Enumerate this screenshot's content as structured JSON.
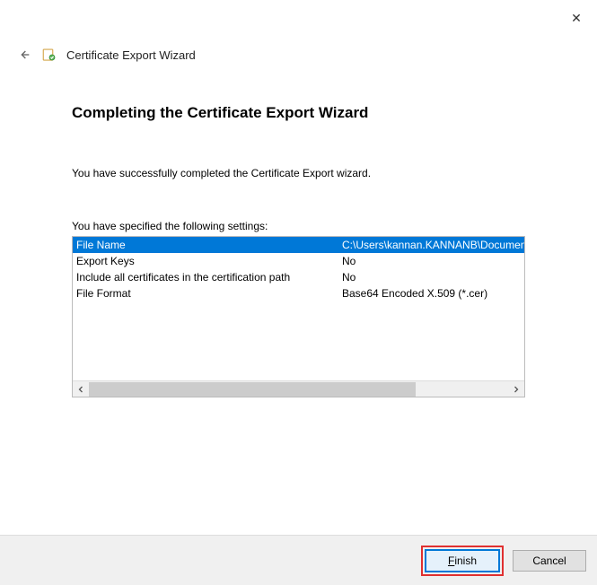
{
  "window": {
    "title": "Certificate Export Wizard"
  },
  "header": {
    "title": "Completing the Certificate Export Wizard"
  },
  "body": {
    "success": "You have successfully completed the Certificate Export wizard.",
    "settings_label": "You have specified the following settings:"
  },
  "settings": [
    {
      "name": "File Name",
      "value": "C:\\Users\\kannan.KANNANB\\Document"
    },
    {
      "name": "Export Keys",
      "value": "No"
    },
    {
      "name": "Include all certificates in the certification path",
      "value": "No"
    },
    {
      "name": "File Format",
      "value": "Base64 Encoded X.509 (*.cer)"
    }
  ],
  "buttons": {
    "finish": "Finish",
    "cancel": "Cancel"
  }
}
